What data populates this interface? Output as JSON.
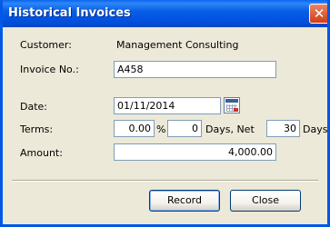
{
  "window": {
    "title": "Historical Invoices",
    "close_symbol": "✕"
  },
  "form": {
    "customer_label": "Customer:",
    "customer_value": "Management Consulting",
    "invoice_label": "Invoice No.:",
    "invoice_value": "A458",
    "date_label": "Date:",
    "date_value": "01/11/2014",
    "calendar_icon": "calendar-icon",
    "terms_label": "Terms:",
    "terms_discount_value": "0.00",
    "percent_symbol": "%",
    "terms_days_value": "0",
    "days_net_label": "Days, Net",
    "terms_net_value": "30",
    "days_label": "Days",
    "amount_label": "Amount:",
    "amount_value": "4,000.00"
  },
  "buttons": {
    "record_label": "Record",
    "close_label": "Close"
  }
}
